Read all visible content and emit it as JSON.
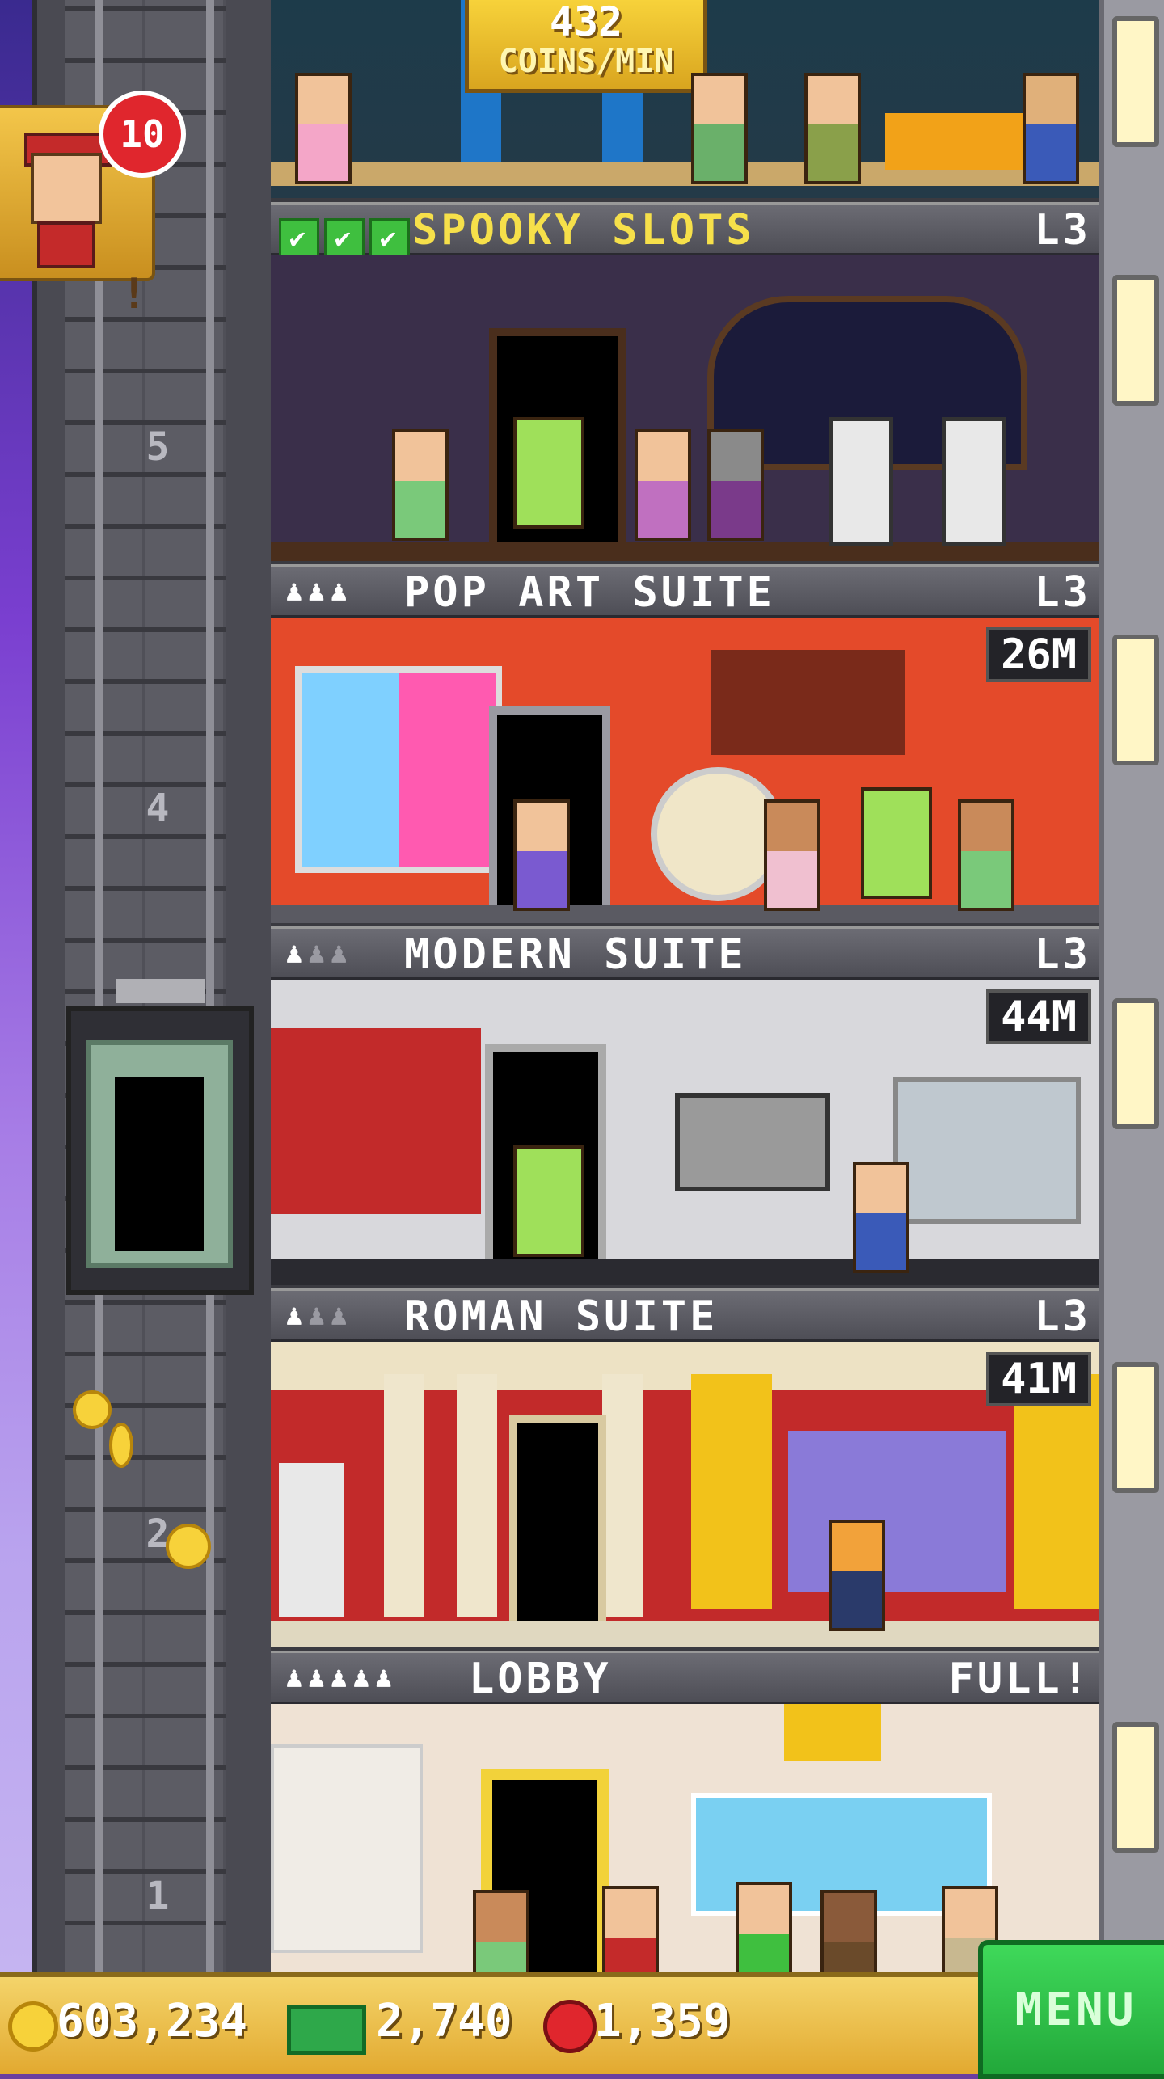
{
  "top_room": {
    "income_value": "432",
    "income_unit": "COINS/MIN"
  },
  "bellhop": {
    "notification_count": "10",
    "alert": "!"
  },
  "elevator_floor_numbers": [
    "5",
    "4",
    "2",
    "1"
  ],
  "floors": [
    {
      "name": "SPOOKY SLOTS",
      "level": "L3",
      "checks": [
        "✔",
        "✔",
        "✔"
      ]
    },
    {
      "name": "POP ART SUITE",
      "level": "L3",
      "residents": "♟♟♟",
      "tag": "26M"
    },
    {
      "name": "MODERN SUITE",
      "level": "L3",
      "residents_active": "♟",
      "residents_inactive": "♟♟",
      "tag": "44M"
    },
    {
      "name": "ROMAN SUITE",
      "level": "L3",
      "residents_active": "♟",
      "residents_inactive": "♟♟",
      "tag": "41M"
    },
    {
      "name": "LOBBY",
      "status": "FULL!",
      "residents": "♟♟♟♟♟"
    }
  ],
  "bottom_bar": {
    "coins": "603,234",
    "bux": "2,740",
    "gems": "1,359",
    "menu_label": "MENU"
  },
  "colors": {
    "accent_yellow": "#f6e04a",
    "menu_green": "#2ec24a",
    "badge_red": "#e0262d"
  }
}
